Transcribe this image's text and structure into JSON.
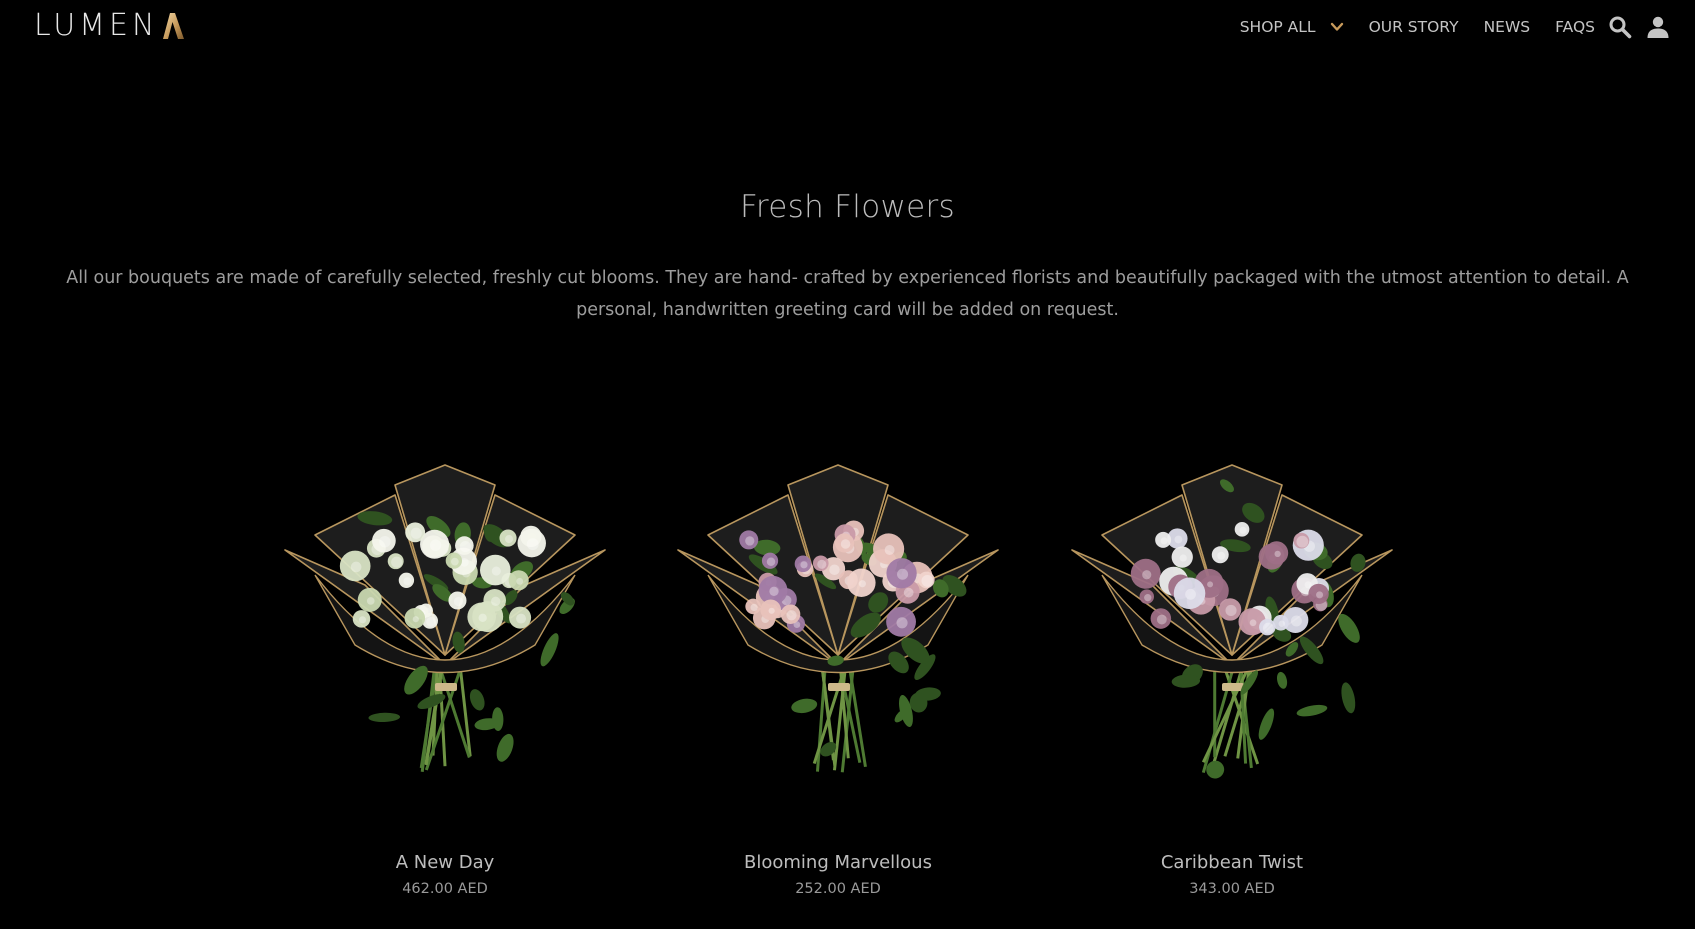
{
  "brand": {
    "logo_text": "LUMEN",
    "logo_accent_letter": "A",
    "accent_color": "#c79a5b"
  },
  "nav": {
    "items": [
      {
        "label": "SHOP ALL",
        "has_dropdown": true
      },
      {
        "label": "OUR STORY"
      },
      {
        "label": "NEWS"
      },
      {
        "label": "FAQS"
      }
    ],
    "icons": [
      "search-icon",
      "account-icon"
    ]
  },
  "intro": {
    "title": "Fresh Flowers",
    "description": "All our bouquets are made of carefully selected, freshly cut blooms. They are hand- crafted by experienced florists and beautifully packaged with the utmost attention to detail. A personal, handwritten greeting card will be added on request."
  },
  "products": [
    {
      "name": "A New Day",
      "price": "462.00 AED",
      "flower_palette": [
        "#e9efdc",
        "#d8e3c4",
        "#f4f6ec",
        "#c9d8b0"
      ]
    },
    {
      "name": "Blooming Marvellous",
      "price": "252.00 AED",
      "flower_palette": [
        "#e8c2bb",
        "#f0d3cc",
        "#c99aa8",
        "#a07aa5"
      ]
    },
    {
      "name": "Caribbean Twist",
      "price": "343.00 AED",
      "flower_palette": [
        "#eeeeee",
        "#c79aa8",
        "#9e6f86",
        "#dcdcea"
      ]
    }
  ],
  "colors": {
    "background": "#000000",
    "text": "#bdbdbd",
    "muted_text": "#9a9a9a",
    "foliage": "#3f6b2a",
    "wrap": "#1d1d1d",
    "wrap_edge": "#b8965e"
  }
}
